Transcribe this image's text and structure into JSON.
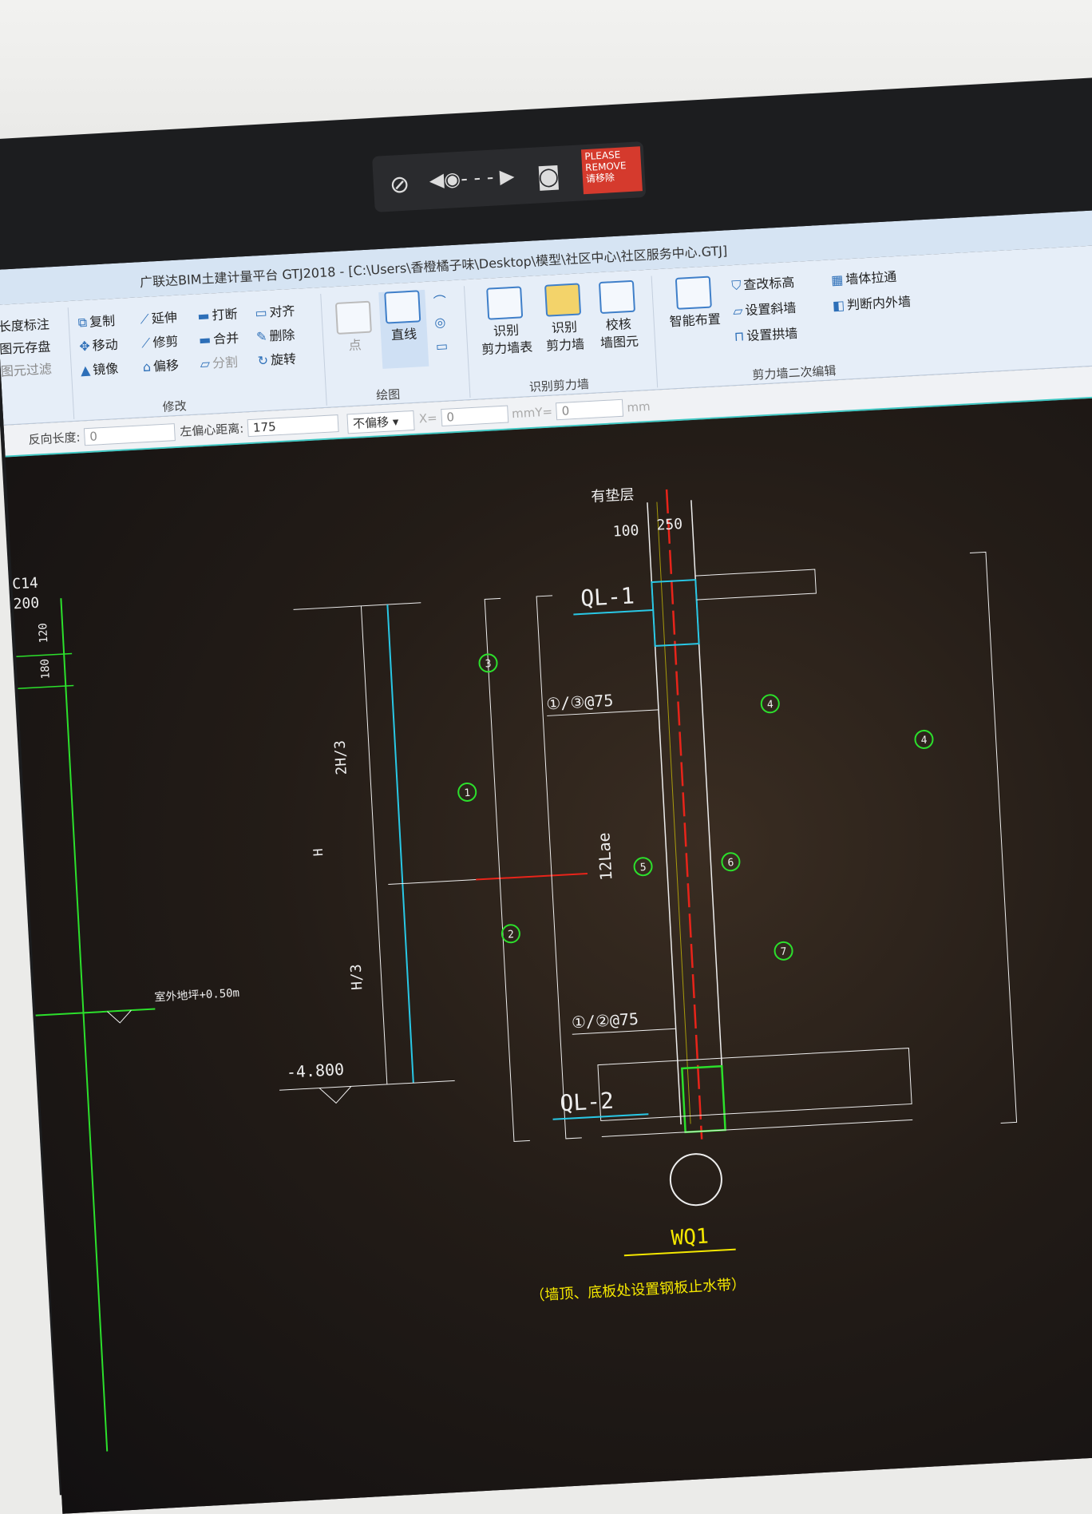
{
  "webcam_cover": {
    "label_en": "PLEASE REMOVE",
    "label_cn": "请移除"
  },
  "window": {
    "title": "广联达BIM土建计量平台 GTJ2018 - [C:\\Users\\香橙橘子味\\Desktop\\模型\\社区中心\\社区服务中心.GTJ]"
  },
  "ribbon": {
    "left_partial": [
      "长度标注",
      "图元存盘",
      "图元过滤"
    ],
    "modify": {
      "items": [
        "复制",
        "延伸",
        "打断",
        "对齐",
        "移动",
        "修剪",
        "合并",
        "删除",
        "镜像",
        "偏移",
        "分割",
        "旋转"
      ],
      "group_label": "修改"
    },
    "draw": {
      "point": "点",
      "line": "直线",
      "group_label": "绘图"
    },
    "identify": {
      "items": [
        "识别\n剪力墙表",
        "识别\n剪力墙",
        "校核\n墙图元"
      ],
      "group_label": "识别剪力墙"
    },
    "secondary": {
      "smart": "智能布置",
      "items": [
        "查改标高",
        "墙体拉通",
        "设置斜墙",
        "判断内外墙",
        "设置拱墙"
      ],
      "group_label": "剪力墙二次编辑"
    }
  },
  "options_bar": {
    "reverse_length_label": "反向长度:",
    "reverse_length_value": "0",
    "left_offset_label": "左偏心距离:",
    "left_offset_value": "175",
    "offset_mode": "不偏移",
    "x_label": "X=",
    "x_value": "0",
    "y_label": "mmY=",
    "y_value": "0",
    "unit": "mm"
  },
  "drawing": {
    "labels": [
      "有垫层",
      "100",
      "250",
      "QL-1",
      "QL-2",
      "WQ1",
      "C14",
      "200",
      "120",
      "180",
      "2H/3",
      "H/3",
      "H",
      "12Lae",
      "-4.800",
      "室外地坪+0.50m"
    ],
    "callouts": [
      "①/③@75",
      "①/②@75"
    ],
    "circles": [
      "1",
      "2",
      "3",
      "4",
      "4",
      "5",
      "6",
      "7"
    ],
    "note": "（墙顶、底板处设置钢板止水带）"
  },
  "colors": {
    "accent": "#3ec8c3",
    "cad_bg": "#151312",
    "cad_green": "#2ce02c",
    "cad_red": "#e8241a",
    "cad_yellow": "#f5e800",
    "cad_cyan": "#29c8e6"
  }
}
